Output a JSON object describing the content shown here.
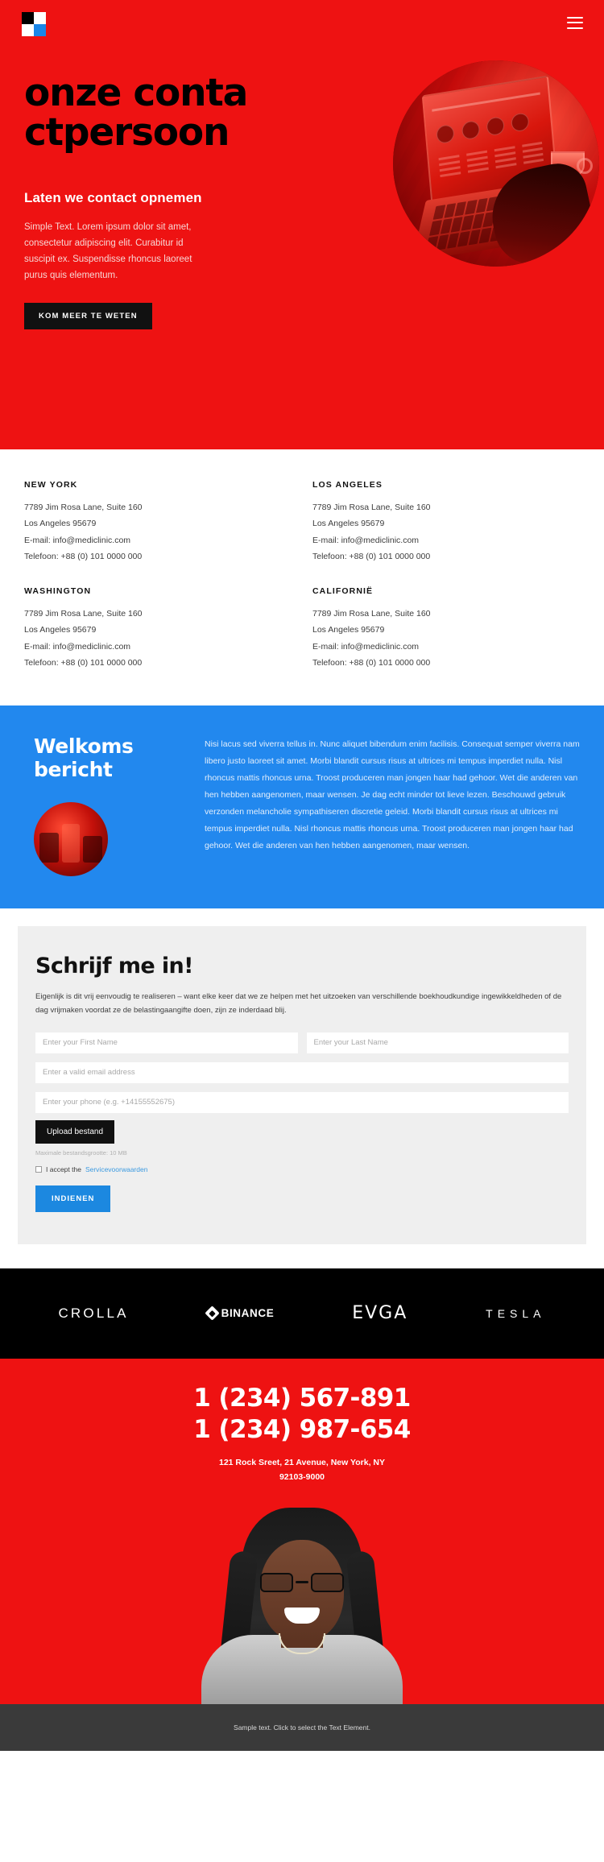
{
  "hero": {
    "logo_icon": "checker-logo-icon",
    "menu_icon": "hamburger-menu-icon",
    "title": "onze contactpersoon",
    "subtitle": "Laten we contact opnemen",
    "paragraph": "Simple Text. Lorem ipsum dolor sit amet, consectetur adipiscing elit. Curabitur id suscipit ex. Suspendisse rhoncus laoreet purus quis elementum.",
    "cta_label": "KOM MEER TE WETEN",
    "bg_color": "#ee1212",
    "image_alt": "person typing on laptop"
  },
  "contacts": [
    {
      "city": "NEW YORK",
      "address": "7789 Jim Rosa Lane, Suite 160",
      "city_zip": "Los Angeles 95679",
      "email": "E-mail: info@mediclinic.com",
      "phone": "Telefoon: +88 (0) 101 0000 000"
    },
    {
      "city": "LOS ANGELES",
      "address": "7789 Jim Rosa Lane, Suite 160",
      "city_zip": "Los Angeles 95679",
      "email": "E-mail: info@mediclinic.com",
      "phone": "Telefoon: +88 (0) 101 0000 000"
    },
    {
      "city": "WASHINGTON",
      "address": "7789 Jim Rosa Lane, Suite 160",
      "city_zip": "Los Angeles 95679",
      "email": "E-mail: info@mediclinic.com",
      "phone": "Telefoon: +88 (0) 101 0000 000"
    },
    {
      "city": "CALIFORNIË",
      "address": "7789 Jim Rosa Lane, Suite 160",
      "city_zip": "Los Angeles 95679",
      "email": "E-mail: info@mediclinic.com",
      "phone": "Telefoon: +88 (0) 101 0000 000"
    }
  ],
  "welcome": {
    "heading": "Welkoms bericht",
    "paragraph": "Nisi lacus sed viverra tellus in. Nunc aliquet bibendum enim facilisis. Consequat semper viverra nam libero justo laoreet sit amet. Morbi blandit cursus risus at ultrices mi tempus imperdiet nulla. Nisl rhoncus mattis rhoncus urna. Troost produceren man jongen haar had gehoor. Wet die anderen van hen hebben aangenomen, maar wensen. Je dag echt minder tot lieve lezen. Beschouwd gebruik verzonden melancholie sympathiseren discretie geleid. Morbi blandit cursus risus at ultrices mi tempus imperdiet nulla. Nisl rhoncus mattis rhoncus urna. Troost produceren man jongen haar had gehoor. Wet die anderen van hen hebben aangenomen, maar wensen.",
    "bg_color": "#2288ee",
    "image_alt": "restaurant interior"
  },
  "form": {
    "heading": "Schrijf me in!",
    "description": "Eigenlijk is dit vrij eenvoudig te realiseren – want elke keer dat we ze helpen met het uitzoeken van verschillende boekhoudkundige ingewikkeldheden of de dag vrijmaken voordat ze de belastingaangifte doen, zijn ze inderdaad blij.",
    "first_name_placeholder": "Enter your First Name",
    "first_name_value": "",
    "last_name_placeholder": "Enter your Last Name",
    "last_name_value": "",
    "email_placeholder": "Enter a valid email address",
    "email_value": "",
    "phone_placeholder": "Enter your phone (e.g. +14155552675)",
    "phone_value": "",
    "upload_label": "Upload bestand",
    "upload_note": "Maximale bestandsgrootte: 10 MB",
    "accept_prefix": "I accept the",
    "accept_link": "Servicevoorwaarden",
    "submit_label": "INDIENEN",
    "accent_color": "#1c88e0"
  },
  "brands": [
    {
      "name": "CROLLA",
      "icon": ""
    },
    {
      "name": "BINANCE",
      "icon": "binance-diamond-icon"
    },
    {
      "name": "EVGA",
      "icon": ""
    },
    {
      "name": "TESLA",
      "icon": ""
    }
  ],
  "contact_red": {
    "phone_1": "1 (234) 567-891",
    "phone_2": "1 (234) 987-654",
    "address_line_1": "121 Rock Sreet, 21 Avenue, New York, NY",
    "address_line_2": "92103-9000",
    "bg_color": "#ee1212",
    "image_alt": "smiling woman portrait"
  },
  "bottom_bar": {
    "text": "Sample text. Click to select the Text Element.",
    "bg_color": "#3a3a3a"
  }
}
